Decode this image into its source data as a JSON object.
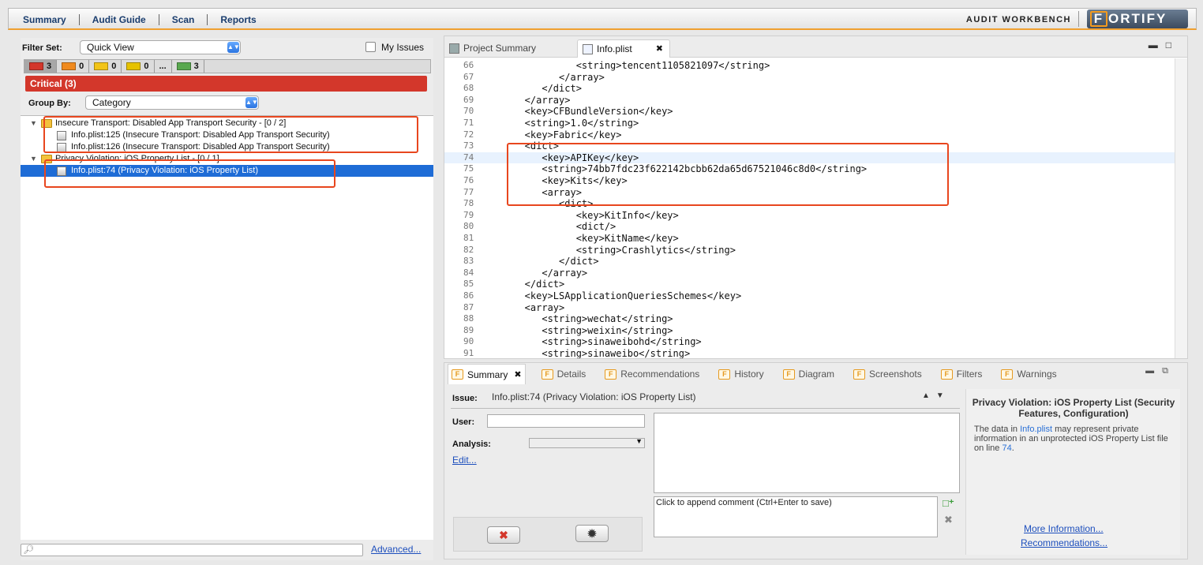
{
  "toolbar": {
    "tabs": [
      "Summary",
      "Audit Guide",
      "Scan",
      "Reports"
    ],
    "workbench_label": "AUDIT WORKBENCH",
    "logo_text": "ORTIFY",
    "logo_first": "F"
  },
  "left": {
    "filter_set_label": "Filter Set:",
    "filter_set_value": "Quick View",
    "my_issues_label": "My Issues",
    "counts": [
      {
        "value": "3",
        "color": "#d3372b"
      },
      {
        "value": "0",
        "color": "#f08a1e"
      },
      {
        "value": "0",
        "color": "#f2c417"
      },
      {
        "value": "0",
        "color": "#e6c200"
      },
      {
        "value": "...",
        "color": ""
      },
      {
        "value": "3",
        "color": "#59a84f"
      }
    ],
    "critical_label": "Critical (3)",
    "group_by_label": "Group By:",
    "group_by_value": "Category",
    "tree": [
      {
        "text": "Insecure Transport: Disabled App Transport Security - [0 / 2]",
        "level": 0
      },
      {
        "text": "Info.plist:125 (Insecure Transport: Disabled App Transport Security)",
        "level": 1
      },
      {
        "text": "Info.plist:126 (Insecure Transport: Disabled App Transport Security)",
        "level": 1
      },
      {
        "text": "Privacy Violation: iOS Property List - [0 / 1]",
        "level": 0
      },
      {
        "text": "Info.plist:74 (Privacy Violation: iOS Property List)",
        "level": 1
      }
    ],
    "advanced_label": "Advanced..."
  },
  "editor": {
    "tabs": [
      "Project Summary",
      "Info.plist"
    ],
    "lines": [
      {
        "n": "66",
        "t": "            <string>tencent1105821097</string>"
      },
      {
        "n": "67",
        "t": "         </array>"
      },
      {
        "n": "68",
        "t": "      </dict>"
      },
      {
        "n": "69",
        "t": "   </array>"
      },
      {
        "n": "70",
        "t": "   <key>CFBundleVersion</key>"
      },
      {
        "n": "71",
        "t": "   <string>1.0</string>"
      },
      {
        "n": "72",
        "t": "   <key>Fabric</key>"
      },
      {
        "n": "73",
        "t": "   <dict>"
      },
      {
        "n": "74",
        "t": "      <key>APIKey</key>"
      },
      {
        "n": "75",
        "t": "      <string>74bb7fdc23f622142bcbb62da65d67521046c8d0</string>"
      },
      {
        "n": "76",
        "t": "      <key>Kits</key>"
      },
      {
        "n": "77",
        "t": "      <array>"
      },
      {
        "n": "78",
        "t": "         <dict>"
      },
      {
        "n": "79",
        "t": "            <key>KitInfo</key>"
      },
      {
        "n": "80",
        "t": "            <dict/>"
      },
      {
        "n": "81",
        "t": "            <key>KitName</key>"
      },
      {
        "n": "82",
        "t": "            <string>Crashlytics</string>"
      },
      {
        "n": "83",
        "t": "         </dict>"
      },
      {
        "n": "84",
        "t": "      </array>"
      },
      {
        "n": "85",
        "t": "   </dict>"
      },
      {
        "n": "86",
        "t": "   <key>LSApplicationQueriesSchemes</key>"
      },
      {
        "n": "87",
        "t": "   <array>"
      },
      {
        "n": "88",
        "t": "      <string>wechat</string>"
      },
      {
        "n": "89",
        "t": "      <string>weixin</string>"
      },
      {
        "n": "90",
        "t": "      <string>sinaweibohd</string>"
      },
      {
        "n": "91",
        "t": "      <string>sinaweibo</string>"
      }
    ]
  },
  "bottom": {
    "tabs": [
      "Summary",
      "Details",
      "Recommendations",
      "History",
      "Diagram",
      "Screenshots",
      "Filters",
      "Warnings"
    ],
    "issue_label": "Issue:",
    "issue_value": "Info.plist:74 (Privacy Violation: iOS Property List)",
    "user_label": "User:",
    "analysis_label": "Analysis:",
    "edit_link": "Edit...",
    "comment_placeholder": "Click to append comment (Ctrl+Enter to save)",
    "info_title": "Privacy Violation: iOS Property List (Security Features, Configuration)",
    "info_pre": "The data in ",
    "info_file": "Info.plist",
    "info_mid": " may represent private information in an unprotected iOS Property List file on line ",
    "info_line": "74",
    "info_end": ".",
    "more_info": "More Information...",
    "recommendations": "Recommendations..."
  }
}
